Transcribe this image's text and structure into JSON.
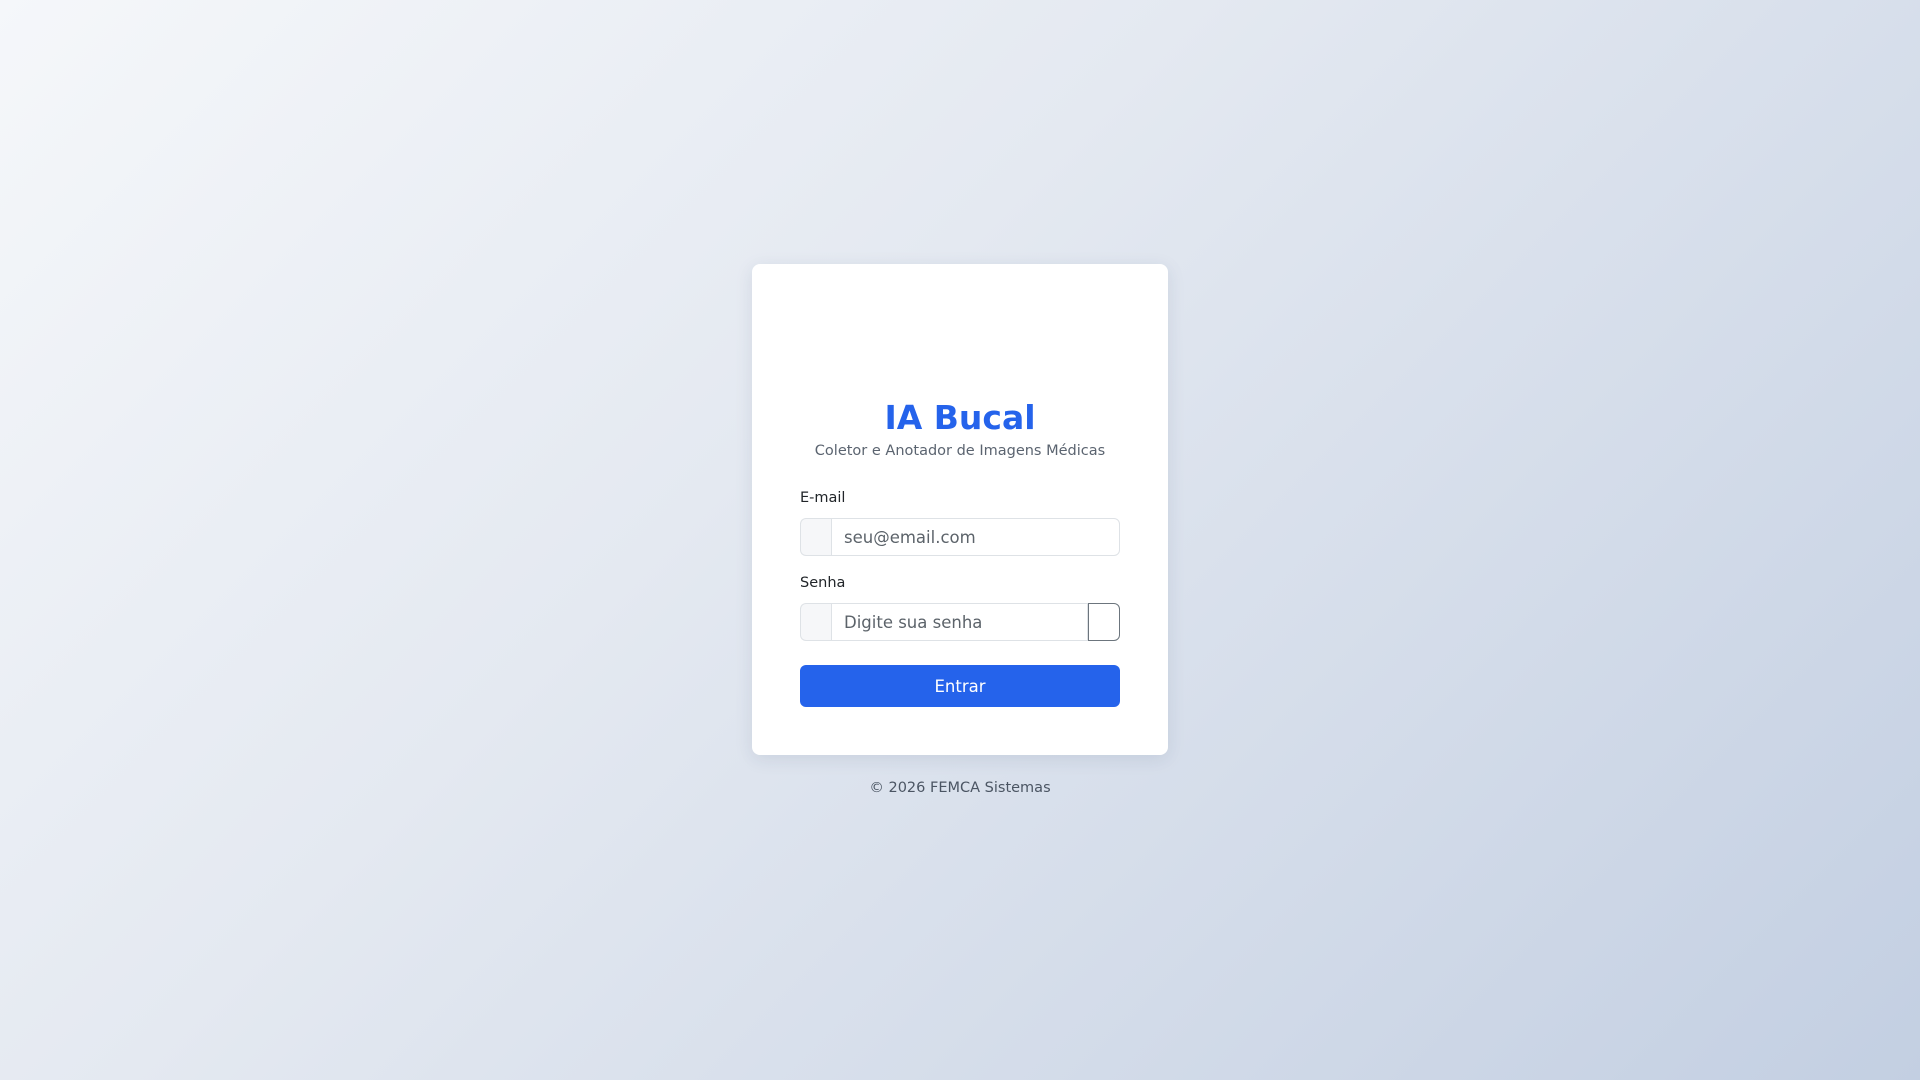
{
  "app": {
    "title": "IA Bucal",
    "subtitle": "Coletor e Anotador de Imagens Médicas"
  },
  "form": {
    "email_label": "E-mail",
    "email_placeholder": "seu@email.com",
    "email_value": "",
    "email_icon": "envelope-icon",
    "password_label": "Senha",
    "password_placeholder": "Digite sua senha",
    "password_value": "",
    "password_icon": "lock-icon",
    "toggle_icon": "eye-icon",
    "submit_label": "Entrar"
  },
  "footer": {
    "text": "© 2026 FEMCA Sistemas"
  },
  "colors": {
    "accent": "#2563eb",
    "card": "#ffffff",
    "background_start": "#f5f7fa",
    "background_end": "#c3cfe2"
  }
}
